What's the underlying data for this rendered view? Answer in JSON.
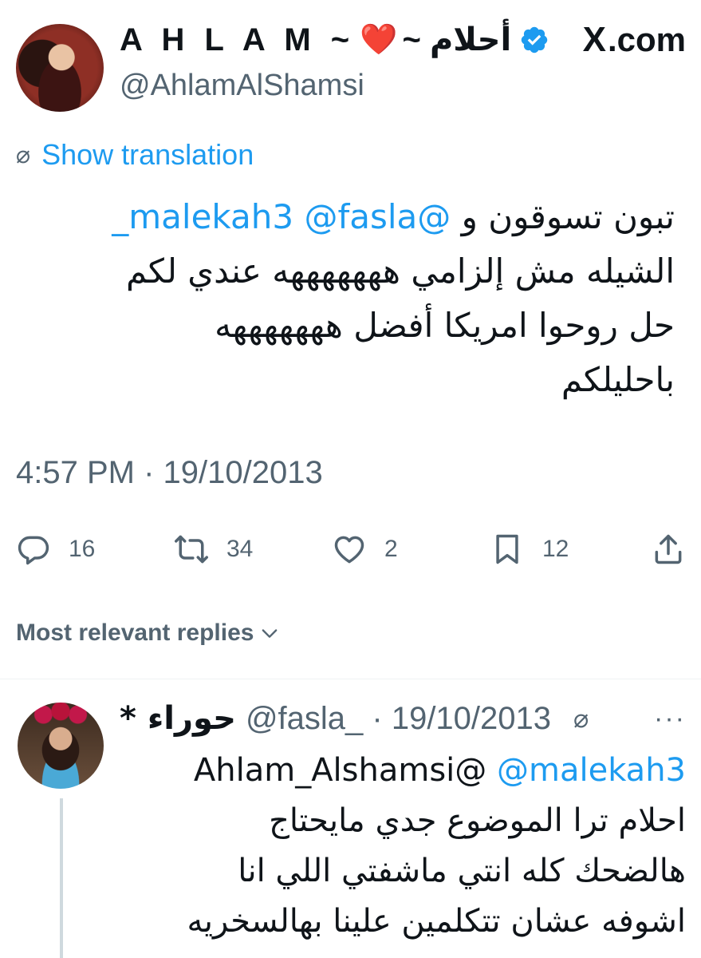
{
  "header": {
    "display_name_latin": "A H L A M ~",
    "display_name_heart": "❤️",
    "display_name_arabic": "~ أحلام",
    "verified_icon": "verified-badge-icon",
    "handle": "@AhlamAlShamsi",
    "brand_logo": "X",
    "brand_suffix": ".com"
  },
  "translation": {
    "icon": "translate-slash-icon",
    "label": "Show translation"
  },
  "tweet": {
    "mention_1": "@malekah3",
    "mention_2": "@fasla_",
    "line1_text": "تبون تسوقون و",
    "line2": "الشيله مش إلزامي هههههههه عندي لكم",
    "line3": "حل روحوا امريكا أفضل هههههههه",
    "line4": "باحليلكم",
    "timestamp": "4:57 PM · 19/10/2013"
  },
  "actions": {
    "replies": "16",
    "reposts": "34",
    "likes": "2",
    "bookmarks": "12"
  },
  "replies_section": {
    "header_label": "Most relevant replies"
  },
  "reply": {
    "name": "* حوراء",
    "meta": "@fasla_ · 19/10/2013",
    "more": "···",
    "mention": "@malekah3",
    "mention_2": "Ahlam_Alshamsi@",
    "line2": "احلام ترا الموضوع جدي مايحتاج",
    "line3": "هالضحك كله انتي ماشفتي اللي انا",
    "line4": "اشوفه عشان تتكلمين علينا بهالسخريه"
  },
  "colors": {
    "accent": "#1d9bf0",
    "secondary_text": "#536471",
    "heart": "#e0243b"
  }
}
